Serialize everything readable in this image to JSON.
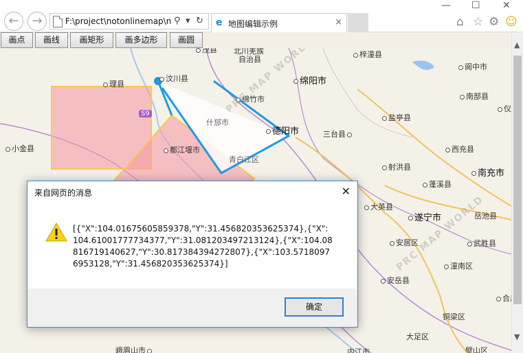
{
  "browser": {
    "back_icon": "back-arrow-icon",
    "forward_icon": "forward-arrow-icon",
    "address": "F:\\project\\notonlinemap\\n",
    "search_glyph": "⚲",
    "dropdown_glyph": "▾",
    "refresh_glyph": "↻",
    "tab_title": "地图编辑示例",
    "tab_close_glyph": "×",
    "minimize_glyph": "—",
    "maximize_glyph": "☐",
    "window_close_glyph": "✕",
    "home_glyph": "⌂",
    "star_glyph": "☆",
    "gear_glyph": "⚙",
    "smiley_glyph": "☺"
  },
  "toolbar": {
    "buttons": [
      "画点",
      "画线",
      "画矩形",
      "画多边形",
      "画圆"
    ]
  },
  "map": {
    "places": [
      {
        "name": "茂县"
      },
      {
        "name": "北川羌族"
      },
      {
        "name": "自治县"
      },
      {
        "name": "梓潼县"
      },
      {
        "name": "汶川县"
      },
      {
        "name": "绵阳市"
      },
      {
        "name": "阆中市"
      },
      {
        "name": "理县"
      },
      {
        "name": "绵竹市"
      },
      {
        "name": "南部县"
      },
      {
        "name": "仪陇"
      },
      {
        "name": "S9"
      },
      {
        "name": "什邡市"
      },
      {
        "name": "德阳市"
      },
      {
        "name": "盐亭县"
      },
      {
        "name": "三台县"
      },
      {
        "name": "小金县"
      },
      {
        "name": "都江堰市"
      },
      {
        "name": "青白江区"
      },
      {
        "name": "西充县"
      },
      {
        "name": "射洪县"
      },
      {
        "name": "南充市"
      },
      {
        "name": "蓬溪县"
      },
      {
        "name": "大英县"
      },
      {
        "name": "岳池县"
      },
      {
        "name": "遂宁市"
      },
      {
        "name": "安居区"
      },
      {
        "name": "武胜县"
      },
      {
        "name": "潼南区"
      },
      {
        "name": "安岳县"
      },
      {
        "name": "合川"
      },
      {
        "name": "铜梁区"
      },
      {
        "name": "大足区"
      },
      {
        "name": "峨眉山市"
      },
      {
        "name": "璧山区"
      },
      {
        "name": "内江市"
      }
    ],
    "watermark": "PRC MAP WORLD"
  },
  "dialog": {
    "title": "来自网页的消息",
    "close_glyph": "✕",
    "message": "[{\"X\":104.01675605859378,\"Y\":31.456820353625374},{\"X\":104.61001777734377,\"Y\":31.081203497213124},{\"X\":104.08816719140627,\"Y\":30.817384394272807},{\"X\":103.57180976953128,\"Y\":31.456820353625374}]",
    "ok_label": "确定"
  },
  "scrollbar": {
    "up_glyph": "▲",
    "down_glyph": "▼"
  }
}
